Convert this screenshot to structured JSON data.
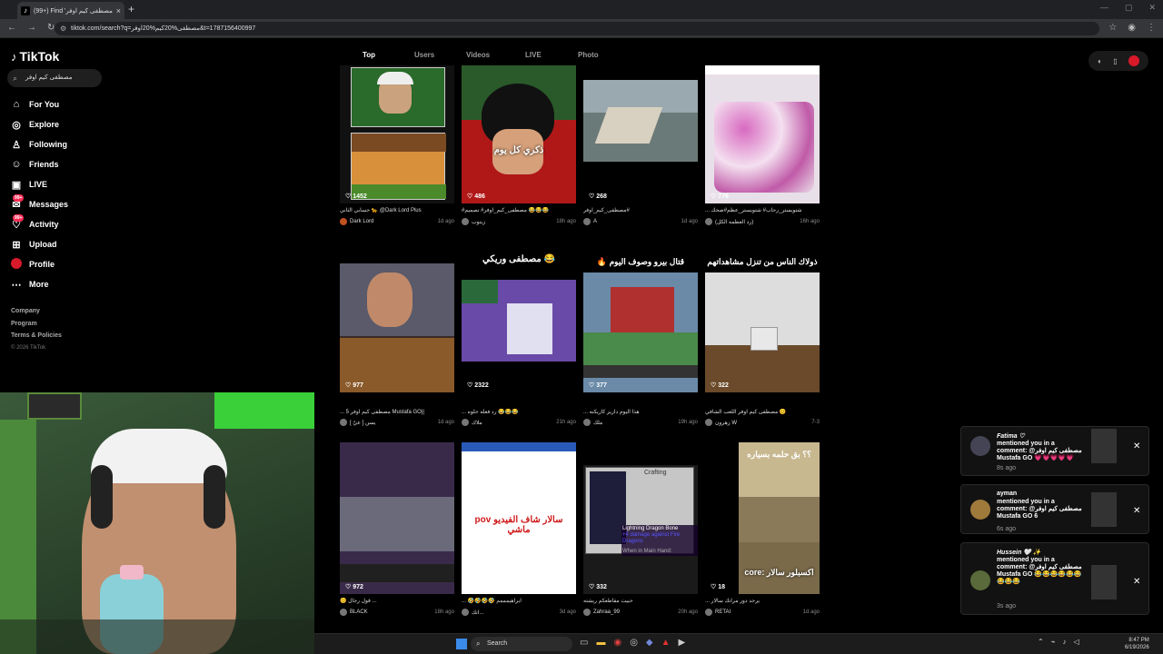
{
  "browser": {
    "tab_title": "(99+) Find 'مصطفى كيم اوفر' on",
    "url": "tiktok.com/search?q=مصطفى%20كيم%20اوفر&t=1787156400997",
    "new_tab": "+",
    "close": "×"
  },
  "sidebar": {
    "logo": "TikTok",
    "search_value": "مصطفى كيم اوفر",
    "items": [
      {
        "label": "For You",
        "icon": "home-icon"
      },
      {
        "label": "Explore",
        "icon": "compass-icon"
      },
      {
        "label": "Following",
        "icon": "following-icon"
      },
      {
        "label": "Friends",
        "icon": "friends-icon"
      },
      {
        "label": "LIVE",
        "icon": "live-icon"
      },
      {
        "label": "Messages",
        "icon": "messages-icon",
        "badge": "99+"
      },
      {
        "label": "Activity",
        "icon": "activity-icon",
        "badge": "99+"
      },
      {
        "label": "Upload",
        "icon": "upload-icon"
      },
      {
        "label": "Profile",
        "icon": "profile-icon"
      },
      {
        "label": "More",
        "icon": "more-icon"
      }
    ],
    "footer": [
      "Company",
      "Program",
      "Terms & Policies"
    ],
    "copyright": "© 2026 TikTok"
  },
  "tabs": [
    "Top",
    "Users",
    "Videos",
    "LIVE",
    "Photo"
  ],
  "videos": [
    {
      "likes": "1452",
      "caption": "حسابي الثاني 🐆 @Dark Lord Plus",
      "author": "Dark Lord",
      "time": "1d ago",
      "overlay": ""
    },
    {
      "likes": "486",
      "caption": "#مصطفى_كيم_اوفر# تصميم 😂😂😂",
      "author": "زيتوب",
      "time": "18h ago",
      "overlay": "ذكري كل يوم"
    },
    {
      "likes": "268",
      "caption": "مصطفى_كيم_اوفر#",
      "author": "A",
      "time": "1d ago",
      "overlay": ""
    },
    {
      "likes": "776",
      "caption": "... شتويستر_رحاب# شتويستر_عظم#ضحك",
      "author": "(رد العظمه الكل)",
      "time": "16h ago",
      "overlay": ""
    },
    {
      "likes": "977",
      "caption": "... مصطفى كيم اوفر 5 Mustafa GO||",
      "author": "يسن [ عيّ ]",
      "time": "1d ago",
      "overlay": ""
    },
    {
      "likes": "2322",
      "caption": "... رد فعله حلوه 😂😂😂",
      "author": "ملاك",
      "time": "21h ago",
      "overlay": ""
    },
    {
      "likes": "377",
      "caption": "... هذا اليوم داريز كاريكته",
      "author": "ملك",
      "time": "19h ago",
      "overlay": ""
    },
    {
      "likes": "322",
      "caption": "مصطفى كيم اوفر اللعب الشافي 😊",
      "author": "زهرون W",
      "time": "7-3",
      "overlay": ""
    },
    {
      "likes": "972",
      "caption": "😊 قول رجال ...",
      "author": "BLACK",
      "time": "18h ago",
      "overlay": ""
    },
    {
      "likes": "",
      "caption": "... 🤣🤣🤣🤣 ابراهيمممم",
      "author": "اتك...",
      "time": "3d ago",
      "overlay": "pov سالار شاف الفيديو ماشي"
    },
    {
      "likes": "332",
      "caption": "حبيت مقاطعكم ريشته",
      "author": "Zahraa_99",
      "time": "20h ago",
      "overlay": ""
    },
    {
      "likes": "18",
      "caption": "... يرحد دور مرانك سالار",
      "author": "RETAI",
      "time": "1d ago",
      "overlay": "core: اكسبلور سالار"
    }
  ],
  "row_captions": {
    "r2_c2": "مصطفى وريكي 😂",
    "r2_c3": "🔥 قتال بيرو وصوف اليوم",
    "r2_c4": "ذولاك الناس من تنزل مشاهداتهم",
    "r3_c4": "؟؟ بق حلمه بسياره"
  },
  "mc_texts": {
    "crafting": "Crafting",
    "item": "Lightning Dragon Bone",
    "damage": "+4 damage against Fire Dragons",
    "hand": "When in Main Hand:"
  },
  "notifications": [
    {
      "name": "Fatima ♡",
      "msg": "mentioned you in a comment: @مصطفى كيم اوفر Mustafa GO 💗💗💗💗💗",
      "ago": "8s ago"
    },
    {
      "name": "ayman",
      "msg": "mentioned you in a comment: @مصطفى كيم اوفر Mustafa GO 6",
      "ago": "6s ago"
    },
    {
      "name": "Hussein 🤍 ✨",
      "msg": "mentioned you in a comment: @مصطفى كيم اوفر Mustafa GO 😂😂😂😂😂😂😂😂😂",
      "ago": "3s ago"
    }
  ],
  "taskbar": {
    "search": "Search",
    "time": "8:47 PM",
    "date": "6/19/2026"
  },
  "colors": {
    "accent": "#fe2c55",
    "background": "#000000"
  }
}
